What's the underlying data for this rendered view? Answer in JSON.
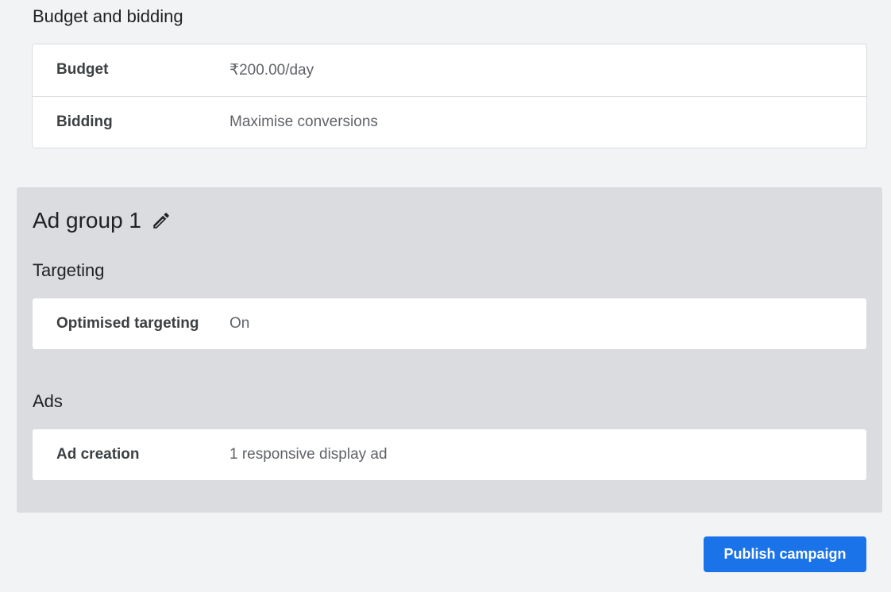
{
  "budget_section": {
    "heading": "Budget and bidding",
    "rows": [
      {
        "label": "Budget",
        "value": "₹200.00/day"
      },
      {
        "label": "Bidding",
        "value": "Maximise conversions"
      }
    ]
  },
  "ad_group": {
    "title": "Ad group 1",
    "edit_icon": "pencil-icon",
    "targeting": {
      "heading": "Targeting",
      "rows": [
        {
          "label": "Optimised targeting",
          "value": "On"
        }
      ]
    },
    "ads": {
      "heading": "Ads",
      "rows": [
        {
          "label": "Ad creation",
          "value": "1 responsive display ad"
        }
      ]
    }
  },
  "actions": {
    "publish_label": "Publish campaign"
  },
  "colors": {
    "background": "#f1f3f4",
    "panel": "#dadce0",
    "accent": "#1a73e8"
  }
}
